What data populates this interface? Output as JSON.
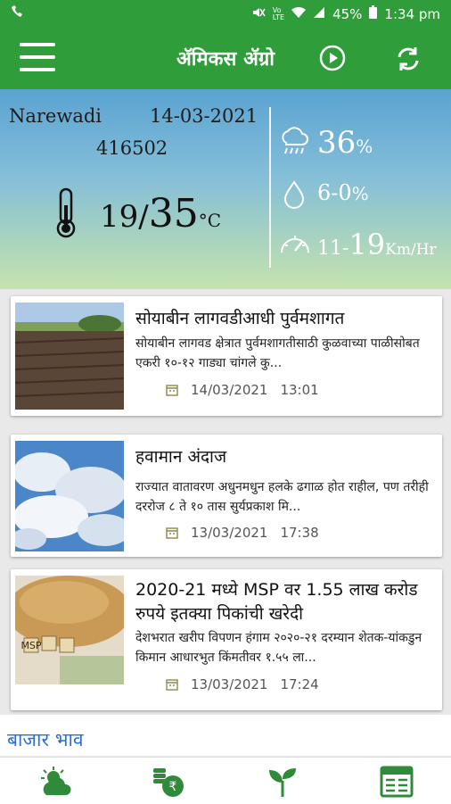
{
  "status": {
    "battery": "45%",
    "time": "1:34 pm"
  },
  "app": {
    "title": "ॲमिकस ॲग्रो"
  },
  "weather": {
    "location": "Narewadi",
    "date": "14-03-2021",
    "pincode": "416502",
    "temp_min": "19",
    "temp_sep": "/",
    "temp_max": "35",
    "temp_unit": "°C",
    "humidity": "36",
    "humidity_unit": "%",
    "rain_min": "6",
    "rain_sep": "-",
    "rain_max": "0",
    "rain_unit": "%",
    "wind_min": "11",
    "wind_sep": "-",
    "wind_max": "19",
    "wind_unit": "Km/Hr"
  },
  "news": [
    {
      "title": "सोयाबीन लागवडीआधी पुर्वमशागत",
      "desc": "सोयाबीन लागवड क्षेत्रात पुर्वमशागतीसाठी कुळवाच्या पाळीसोबत एकरी १०-१२ गाड्या चांगले कु...",
      "date": "14/03/2021",
      "time": "13:01"
    },
    {
      "title": "हवामान अंदाज",
      "desc": "राज्यात वातावरण अधुनमधुन हलके ढगाळ होत राहील, पण तरीही दररोज ८ ते १० तास सुर्यप्रकाश मि...",
      "date": "13/03/2021",
      "time": "17:38"
    },
    {
      "title": "2020-21 मध्ये MSP वर 1.55 लाख करोड रुपये इतक्या पिकांची खरेदी",
      "desc": "देशभरात खरीप विपणन हंगाम २०२०-२१ दरम्यान शेतक-यांकडुन किमान आधारभुत किंमतीवर १.५५ ला...",
      "date": "13/03/2021",
      "time": "17:24"
    }
  ],
  "msp_sign": "MSP",
  "section": {
    "market_title": "बाजार भाव"
  },
  "nav": [
    "weather-icon",
    "rupee-coins-icon",
    "plant-icon",
    "news-icon"
  ]
}
